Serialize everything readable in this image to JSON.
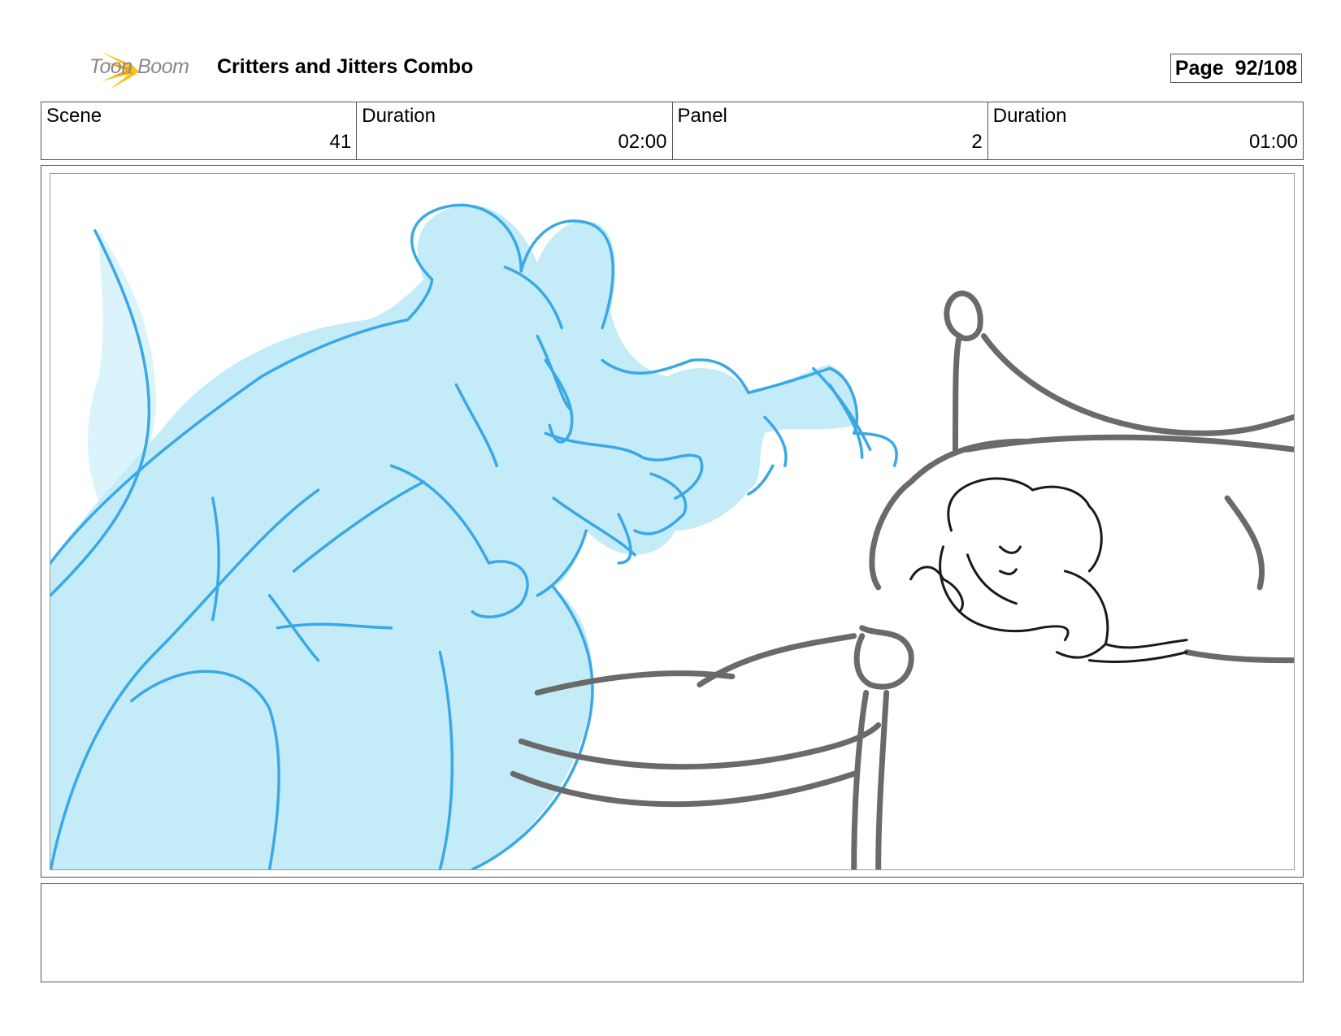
{
  "header": {
    "logo_text": "Toon Boom",
    "project_title": "Critters and Jitters Combo",
    "page_label": "Page",
    "page_number": "92/108"
  },
  "info": {
    "scene_label": "Scene",
    "scene_value": "41",
    "scene_duration_label": "Duration",
    "scene_duration_value": "02:00",
    "panel_label": "Panel",
    "panel_value": "2",
    "panel_duration_label": "Duration",
    "panel_duration_value": "01:00"
  },
  "colors": {
    "logo_star": "#f5c518",
    "ghost_fill": "#c3ecf8",
    "ghost_line": "#3aa8e6",
    "bed_line": "#6a6a6a",
    "child_line": "#1a1a1a"
  },
  "notes": {
    "text": ""
  }
}
